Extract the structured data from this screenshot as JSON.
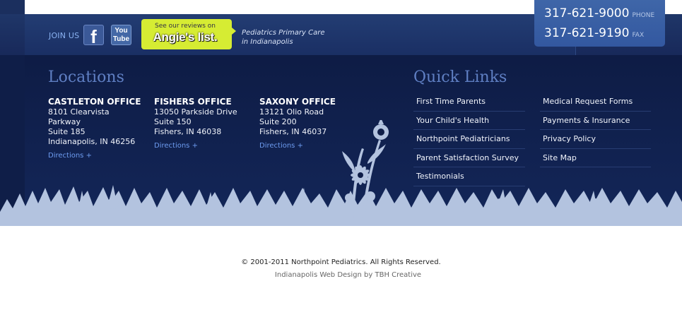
{
  "social": {
    "join_label": "JOIN US",
    "facebook_icon": "f",
    "youtube_icon_line1": "You",
    "youtube_icon_line2": "Tube"
  },
  "angies": {
    "top_text": "See our reviews on",
    "logo_text": "Angie's list."
  },
  "tagline": {
    "line1": "Pediatrics Primary Care",
    "line2": "in Indianapolis"
  },
  "phones": [
    {
      "number": "317-621-9000",
      "label": "PHONE"
    },
    {
      "number": "317-621-9190",
      "label": "FAX"
    }
  ],
  "locations": {
    "heading": "Locations",
    "offices": [
      {
        "title": "CASTLETON OFFICE",
        "lines": [
          "8101 Clearvista",
          "Parkway",
          "Suite 185",
          "Indianapolis, IN 46256"
        ],
        "directions": "Directions +"
      },
      {
        "title": "FISHERS OFFICE",
        "lines": [
          "13050 Parkside Drive",
          "Suite 150",
          "Fishers, IN 46038"
        ],
        "directions": "Directions +"
      },
      {
        "title": "SAXONY OFFICE",
        "lines": [
          "13121 Olio Road",
          "Suite 200",
          "Fishers, IN 46037"
        ],
        "directions": "Directions +"
      }
    ]
  },
  "quick_links": {
    "heading": "Quick Links",
    "col1": [
      "First Time Parents",
      "Your Child's Health",
      "Northpoint Pediatricians",
      "Parent Satisfaction Survey",
      "Testimonials"
    ],
    "col2": [
      "Medical Request Forms",
      "Payments & Insurance",
      "Privacy Policy",
      "Site Map"
    ]
  },
  "footer": {
    "copyright": "© 2001-2011 Northpoint Pediatrics. All Rights Reserved.",
    "credit": "Indianapolis Web Design by TBH Creative"
  },
  "colors": {
    "navy": "#0f1e48",
    "accent_blue": "#5f7fc3",
    "link_blue": "#6d9cf0",
    "angies_green": "#d6ec33",
    "plants": "#b3c3df"
  }
}
